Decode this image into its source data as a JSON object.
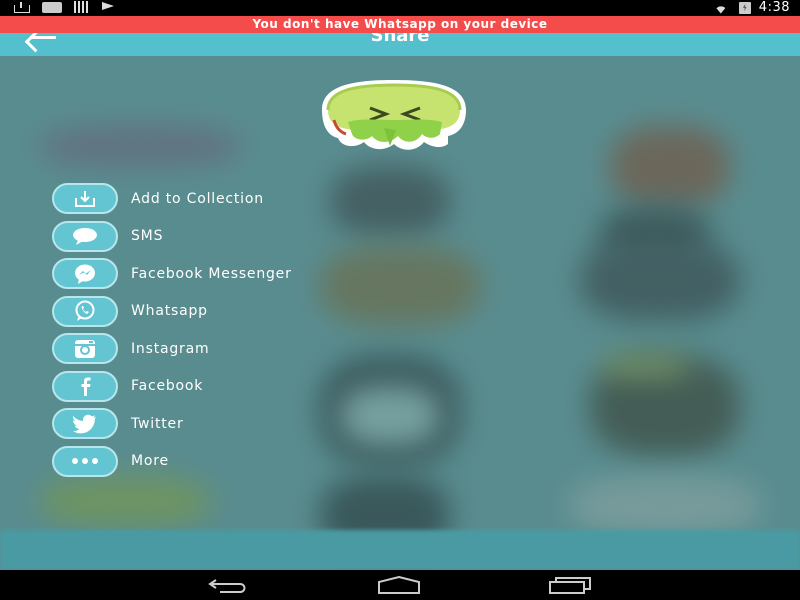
{
  "status_bar": {
    "time": "4:38",
    "icons": [
      "download-icon",
      "photo-icon",
      "signal-bars-icon",
      "flag-icon",
      "wifi-icon",
      "battery-charging-icon"
    ]
  },
  "banner": {
    "message": "You don't have Whatsapp on your device",
    "color": "#f44b4b"
  },
  "app_bar": {
    "title": "Share",
    "back_icon": "back-arrow-icon",
    "color": "#55c0cd"
  },
  "share_menu": {
    "items": [
      {
        "label": "Add to Collection",
        "icon": "download-icon"
      },
      {
        "label": "SMS",
        "icon": "chat-bubble-icon"
      },
      {
        "label": "Facebook Messenger",
        "icon": "messenger-icon"
      },
      {
        "label": "Whatsapp",
        "icon": "whatsapp-icon"
      },
      {
        "label": "Instagram",
        "icon": "instagram-icon"
      },
      {
        "label": "Facebook",
        "icon": "facebook-icon"
      },
      {
        "label": "Twitter",
        "icon": "twitter-icon"
      },
      {
        "label": "More",
        "icon": "more-dots-icon"
      }
    ],
    "accent": "#63c5d2"
  },
  "nav_bar": {
    "buttons": [
      "back-nav-icon",
      "home-nav-icon",
      "recents-nav-icon"
    ]
  }
}
